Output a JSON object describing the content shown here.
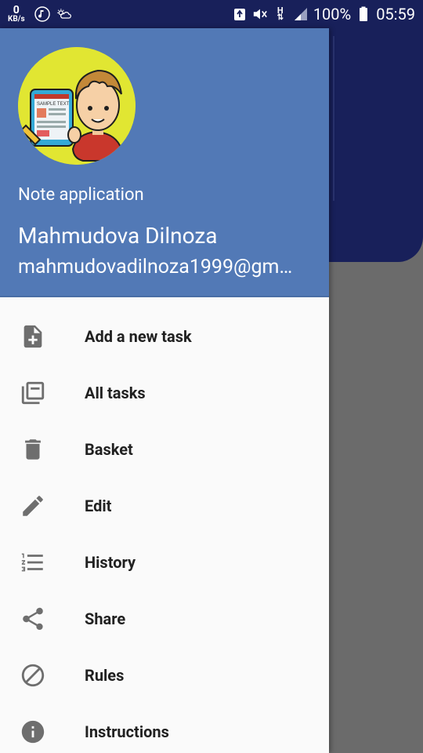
{
  "status_bar": {
    "kb_value": "0",
    "kb_unit": "KB/s",
    "battery_pct": "100%",
    "time": "05:59",
    "network": "H"
  },
  "drawer": {
    "app_name": "Note application",
    "user_name": "Mahmudova Dilnoza",
    "user_email": "mahmudovadilnoza1999@gmail.com",
    "avatar_sample_text": "SAMPLE TEXT",
    "menu": [
      {
        "label": "Add a new task",
        "icon": "note-add-icon"
      },
      {
        "label": "All tasks",
        "icon": "library-icon"
      },
      {
        "label": "Basket",
        "icon": "trash-icon"
      },
      {
        "label": "Edit",
        "icon": "pencil-icon"
      },
      {
        "label": "History",
        "icon": "numbered-list-icon"
      },
      {
        "label": "Share",
        "icon": "share-icon"
      },
      {
        "label": "Rules",
        "icon": "block-icon"
      },
      {
        "label": "Instructions",
        "icon": "info-icon"
      }
    ]
  },
  "colors": {
    "drawer_header": "#5279b6",
    "status_bar": "#18205a",
    "icon_gray": "#6e6e6e",
    "scrim": "#6b6b6b"
  }
}
